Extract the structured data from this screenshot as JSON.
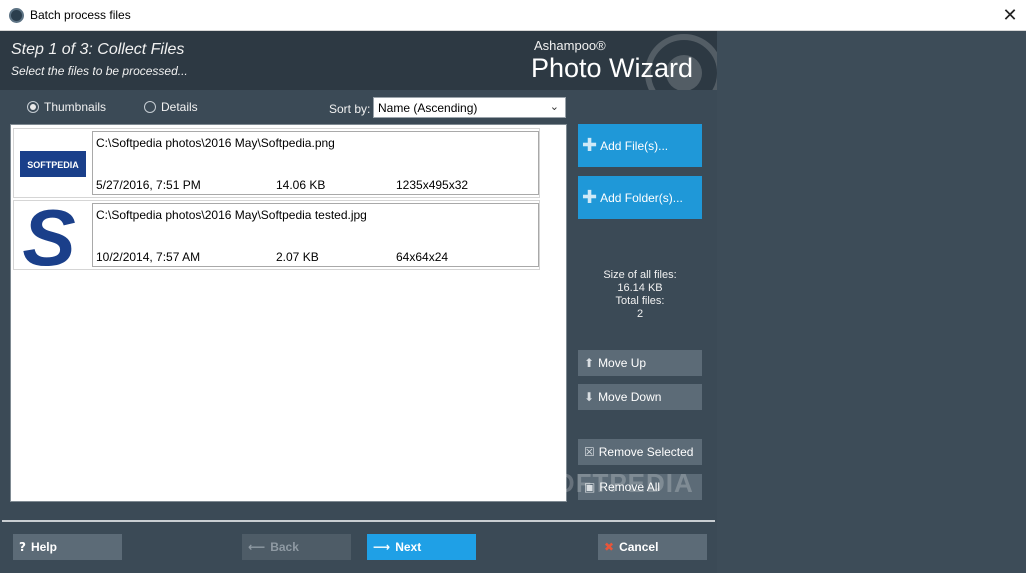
{
  "window": {
    "title": "Batch process files",
    "close_glyph": "✕",
    "icon": "app-icon"
  },
  "header": {
    "step_title": "Step 1 of 3: Collect Files",
    "step_subtitle": "Select the files to be processed...",
    "brand_small": "Ashampoo®",
    "brand_big": "Photo Wizard"
  },
  "view": {
    "thumbnails_label": "Thumbnails",
    "details_label": "Details",
    "selected": "Thumbnails",
    "sort_label": "Sort by:",
    "sort_value": "Name (Ascending)"
  },
  "files": [
    {
      "path": "C:\\Softpedia photos\\2016 May\\Softpedia.png",
      "date": "5/27/2016, 7:51 PM",
      "size": "14.06 KB",
      "dims": "1235x495x32",
      "thumb_text": "SOFTPEDIA"
    },
    {
      "path": "C:\\Softpedia photos\\2016 May\\Softpedia tested.jpg",
      "date": "10/2/2014, 7:57 AM",
      "size": "2.07 KB",
      "dims": "64x64x24",
      "thumb_text": "S"
    }
  ],
  "actions": {
    "add_files": "Add File(s)...",
    "add_folder": "Add Folder(s)...",
    "move_up": "Move Up",
    "move_down": "Move Down",
    "remove_selected": "Remove Selected",
    "remove_all": "Remove All"
  },
  "stats": {
    "size_label": "Size of all files:",
    "size_value": "16.14 KB",
    "total_label": "Total files:",
    "total_value": "2"
  },
  "footer": {
    "help": "Help",
    "back": "Back",
    "next": "Next",
    "cancel": "Cancel"
  },
  "watermark": "SOFTPEDIA",
  "colors": {
    "accent": "#1f98d8",
    "next_button": "#1fa0e6",
    "panel": "#3b4a56",
    "header": "#2d3943",
    "softpedia_blue": "#1a3f8a"
  }
}
